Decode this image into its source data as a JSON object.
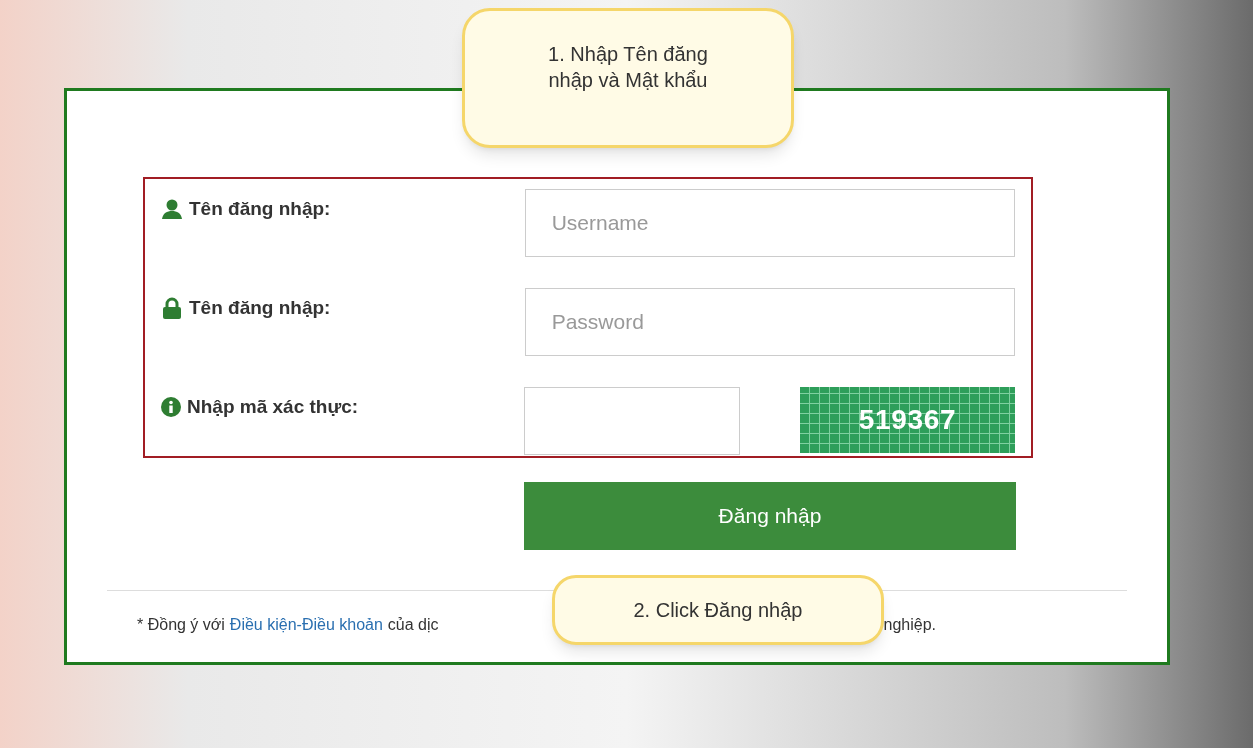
{
  "callouts": [
    {
      "text": "1. Nhập Tên đăng nhập và Mật khẩu"
    },
    {
      "text": "2. Click Đăng nhập"
    }
  ],
  "form": {
    "fields": [
      {
        "kind": "user",
        "label": "Tên đăng nhập:",
        "placeholder": "Username"
      },
      {
        "kind": "lock",
        "label": "Tên đăng nhập:",
        "placeholder": "Password"
      },
      {
        "kind": "captcha",
        "label": "Nhập mã xác thực:",
        "captcha_code": "519367"
      }
    ],
    "submit": "Đăng nhập"
  },
  "footer": {
    "prefix": "* Đồng ý với",
    "link": "Điều kiện-Điều khoản",
    "middle": "của dịc",
    "suffix": "nghiệp."
  }
}
